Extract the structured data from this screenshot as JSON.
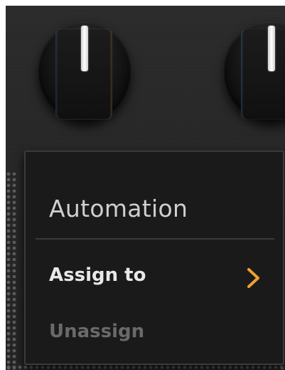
{
  "menu": {
    "title": "Automation",
    "items": [
      {
        "label": "Assign to",
        "enabled": true,
        "has_submenu": true
      },
      {
        "label": "Unassign",
        "enabled": false,
        "has_submenu": false
      }
    ]
  },
  "icons": {
    "submenu": "chevron-right-icon"
  },
  "colors": {
    "panel_background": "#262626",
    "menu_background": "#1a1a1a",
    "menu_border": "#3b3b3b",
    "title_text": "#cfcfcf",
    "enabled_item_text": "#e8e8e8",
    "disabled_item_text": "#6a6a6a",
    "chevron_accent": "#f0a030"
  }
}
